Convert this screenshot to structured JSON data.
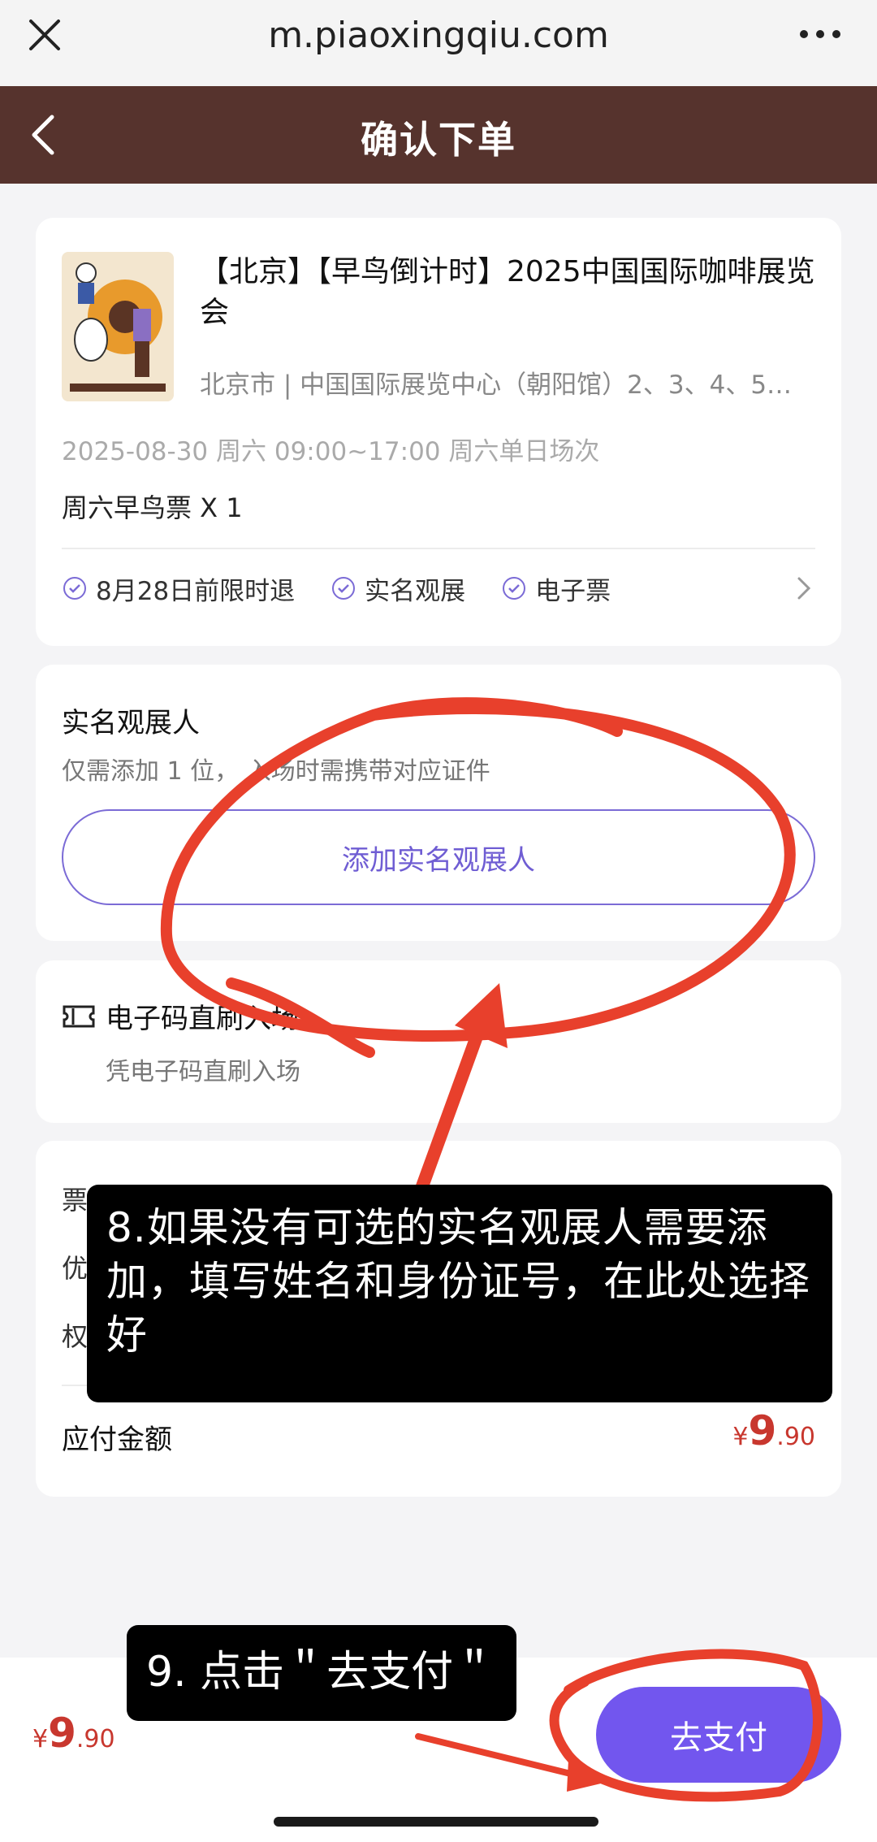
{
  "browser": {
    "url": "m.piaoxingqiu.com",
    "close_icon": "close-icon",
    "more_icon": "more-icon"
  },
  "nav": {
    "title": "确认下单",
    "back_icon": "back-chevron-icon",
    "background": "#56332d"
  },
  "event": {
    "title": "【北京】【早鸟倒计时】2025中国国际咖啡展览会",
    "venue": "北京市 | 中国国际展览中心（朝阳馆）2、3、4、5…",
    "time": "2025-08-30 周六 09:00~17:00 周六单日场次",
    "ticket": "周六早鸟票 X 1",
    "policies": [
      "8月28日前限时退",
      "实名观展",
      "电子票"
    ]
  },
  "visitor": {
    "title": "实名观展人",
    "subtitle": "仅需添加 1 位， 入场时需携带对应证件",
    "add_button": "添加实名观展人"
  },
  "entry": {
    "title": "电子码直刷入场",
    "subtitle": "凭电子码直刷入场"
  },
  "price": {
    "rows": [
      "票",
      "优",
      "权"
    ],
    "total_label": "应付金额",
    "currency": "¥",
    "amount_int": "9",
    "amount_dec": ".90"
  },
  "bottom": {
    "currency": "¥",
    "amount_int": "9",
    "amount_dec": ".90",
    "pay_button": "去支付"
  },
  "annotations": {
    "step8": "8.如果没有可选的实名观展人需要添加，填写姓名和身份证号，在此处选择好",
    "step9": "9. 点击＂去支付＂"
  },
  "colors": {
    "accent": "#7256ee",
    "price": "#c8372e",
    "annotation": "#e8402c"
  }
}
